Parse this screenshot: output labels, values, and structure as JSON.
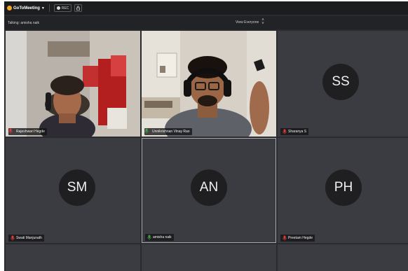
{
  "app": {
    "name": "GoToMeeting",
    "rec_label": "REC",
    "talking_label": "Talking: amisha naik",
    "view_label": "View Everyone"
  },
  "participants": [
    {
      "name": "Rajeshwari Hegde",
      "mic": "muted",
      "type": "video"
    },
    {
      "name": "Unnikrishnan Vinay Rao",
      "mic": "active",
      "type": "video"
    },
    {
      "name": "Sharanya S",
      "mic": "muted",
      "type": "avatar",
      "initials": "SS"
    },
    {
      "name": "Swati Manjunath",
      "mic": "muted",
      "type": "avatar",
      "initials": "SM"
    },
    {
      "name": "amisha naik",
      "mic": "active",
      "type": "avatar",
      "initials": "AN",
      "active_speaker": true
    },
    {
      "name": "Preetam Hegde",
      "mic": "muted",
      "type": "avatar",
      "initials": "PH"
    }
  ],
  "colors": {
    "muted_mic": "#e53935",
    "active_mic": "#43a047",
    "tile_bg": "#3b3c41",
    "avatar_bg": "#1f1f21"
  }
}
